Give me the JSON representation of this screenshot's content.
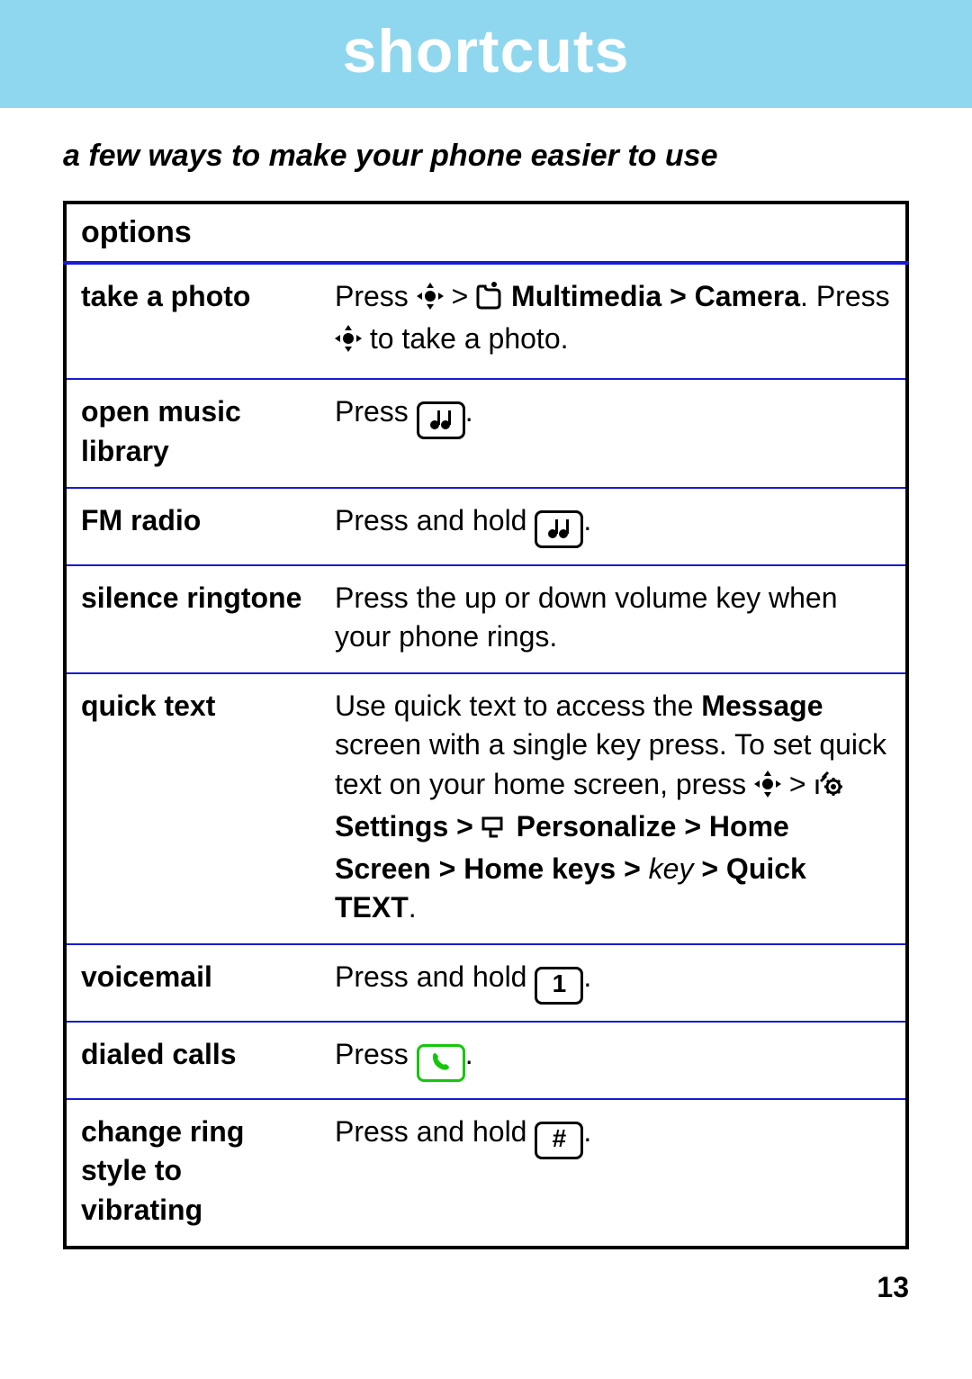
{
  "header": {
    "title": "shortcuts"
  },
  "subtitle": "a few ways to make your phone easier to use",
  "table": {
    "header": "options",
    "rows": [
      {
        "label": "take a photo",
        "desc_parts": {
          "p1": "Press ",
          "gt1": " > ",
          "multimedia": " Multimedia > Camera",
          "p2": ". Press ",
          "p3": " to take a photo."
        }
      },
      {
        "label": "open music library",
        "desc_parts": {
          "p1": "Press ",
          "p2": "."
        }
      },
      {
        "label": "FM radio",
        "desc_parts": {
          "p1": "Press and hold ",
          "p2": "."
        }
      },
      {
        "label": "silence ringtone",
        "desc_plain": "Press the up or down volume key when your phone rings."
      },
      {
        "label": "quick text",
        "desc_parts": {
          "p1": "Use quick text to access the ",
          "msg": "Message",
          "p2": " screen with a single key press. To set quick text on your home screen, press ",
          "gt1": " > ",
          "settings": " Settings > ",
          "personalize": " Personalize > Home Screen > Home keys > ",
          "key_i": "key",
          "quick": " > Quick TEXT",
          "p3": "."
        }
      },
      {
        "label": "voicemail",
        "desc_parts": {
          "p1": "Press and hold ",
          "key": "1",
          "p2": "."
        }
      },
      {
        "label": "dialed calls",
        "desc_parts": {
          "p1": "Press ",
          "p2": "."
        }
      },
      {
        "label": "change ring style to vibrating",
        "desc_parts": {
          "p1": "Press and hold ",
          "key": "#",
          "p2": "."
        }
      }
    ]
  },
  "page_number": "13"
}
